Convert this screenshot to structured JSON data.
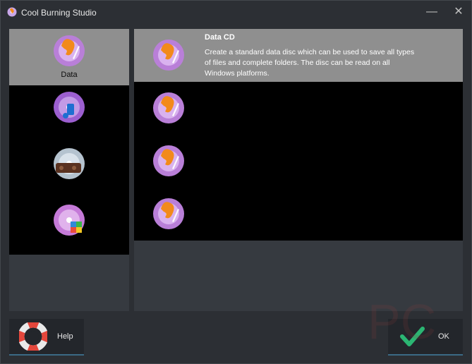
{
  "window": {
    "title": "Cool Burning Studio"
  },
  "categories": [
    {
      "label": "Data",
      "icon": "data-disc-flame-icon"
    },
    {
      "label": "",
      "icon": "audio-disc-icon"
    },
    {
      "label": "",
      "icon": "video-disc-icon"
    },
    {
      "label": "",
      "icon": "image-disc-icon"
    }
  ],
  "items": [
    {
      "name": "Data CD",
      "description": "Create a standard data disc which can be used to save all types of files and complete folders. The disc can be read on all Windows platforms.",
      "icon": "data-cd-icon"
    },
    {
      "name": "",
      "description": "",
      "icon": "data-disc-icon"
    },
    {
      "name": "",
      "description": "",
      "icon": "data-disc-icon"
    },
    {
      "name": "",
      "description": "",
      "icon": "data-disc-icon"
    }
  ],
  "buttons": {
    "help": "Help",
    "ok": "OK"
  },
  "colors": {
    "selected": "#8f8f8f",
    "panel": "#363a40",
    "accent": "#3b6a85",
    "ok_check": "#2bb673"
  }
}
